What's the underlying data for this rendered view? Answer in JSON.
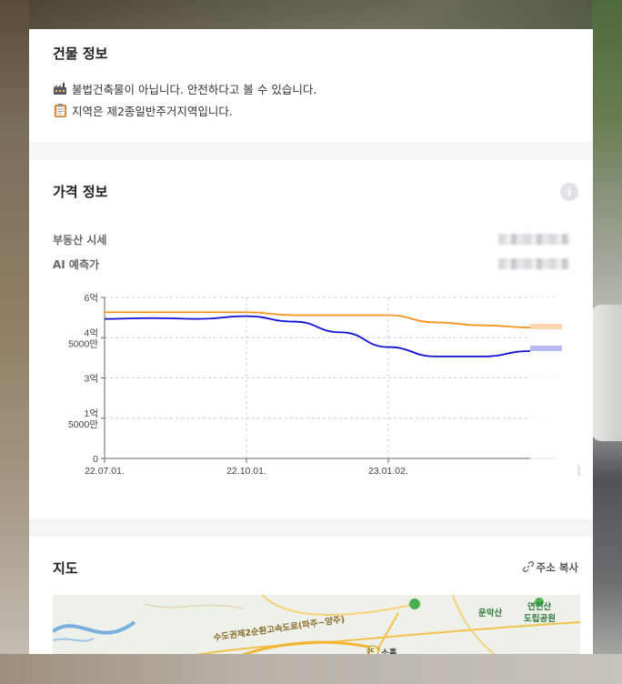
{
  "building": {
    "title": "건물 정보",
    "rows": [
      {
        "icon": "factory-icon",
        "text": "불법건축물이 아닙니다. 안전하다고 볼 수 있습니다."
      },
      {
        "icon": "clipboard-icon",
        "text": "지역은 제2종일반주거지역입니다."
      }
    ]
  },
  "price": {
    "title": "가격 정보",
    "info_icon": "i",
    "market_label": "부동산 시세",
    "ai_label": "AI 예측가"
  },
  "map": {
    "title": "지도",
    "copy_label": "주소 복사",
    "labels": {
      "road": "수도권제2순환고속도로(파주~양주)",
      "mountain": "운악산",
      "park_line1": "연인산",
      "park_line2": "도립공원",
      "jc_badge": "JC",
      "jc_name": "소흘"
    }
  },
  "colors": {
    "market_line": "#f7931e",
    "ai_line": "#1010d8",
    "grid": "#cccccc"
  },
  "chart_data": {
    "type": "line",
    "x": [
      "22.07.01.",
      "22.08.01.",
      "22.09.01.",
      "22.10.01.",
      "22.11.01.",
      "22.12.01.",
      "23.01.02.",
      "23.02.01.",
      "23.03.01.",
      "23.04.01."
    ],
    "x_ticks": [
      "22.07.01.",
      "22.10.01.",
      "23.01.02."
    ],
    "y_ticks": [
      {
        "value": 0,
        "label": "0"
      },
      {
        "value": 15000,
        "label_top": "1억",
        "label_bottom": "5000만"
      },
      {
        "value": 30000,
        "label": "3억"
      },
      {
        "value": 45000,
        "label_top": "4억",
        "label_bottom": "5000만"
      },
      {
        "value": 60000,
        "label": "6억"
      }
    ],
    "ylim": [
      0,
      60000
    ],
    "series": [
      {
        "name": "부동산 시세",
        "values": [
          54500,
          54500,
          54500,
          54500,
          53400,
          53400,
          53400,
          50700,
          49600,
          48800
        ]
      },
      {
        "name": "AI 예측가",
        "values": [
          52000,
          52300,
          52000,
          53000,
          51000,
          47000,
          41500,
          38000,
          38000,
          40000
        ]
      }
    ]
  }
}
